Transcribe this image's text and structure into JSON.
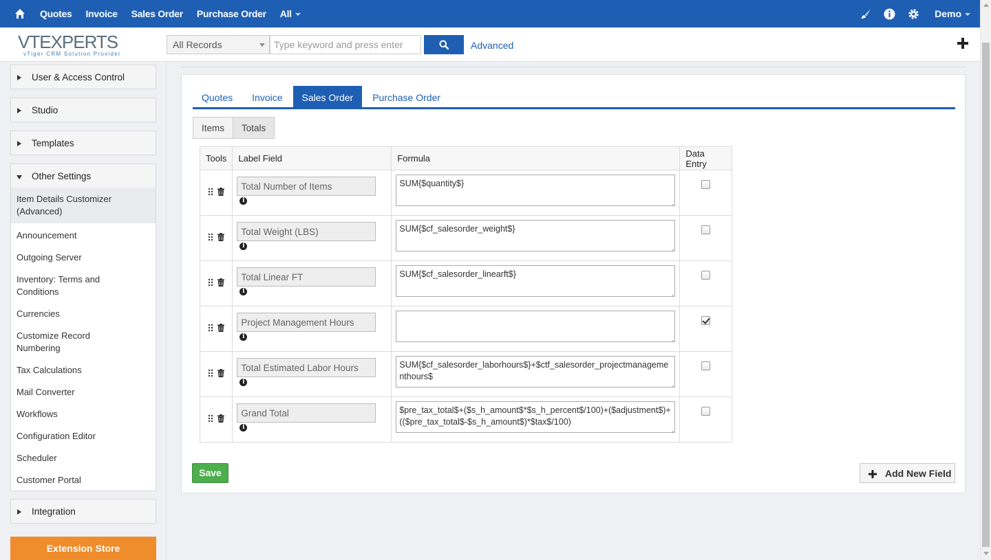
{
  "topnav": {
    "items": [
      "Quotes",
      "Invoice",
      "Sales Order",
      "Purchase Order",
      "All"
    ],
    "user": "Demo",
    "icons": [
      "home-icon",
      "brush-icon",
      "info-icon",
      "gear-icon"
    ]
  },
  "header": {
    "logo_main": "VTEXPERTS",
    "logo_sub": "vTiger CRM Solution Provider",
    "record_select": "All Records",
    "search_placeholder": "Type keyword and press enter",
    "advanced": "Advanced"
  },
  "sidebar": {
    "sections": [
      "User & Access Control",
      "Studio",
      "Templates",
      "Other Settings",
      "Integration"
    ],
    "items": [
      "Item Details Customizer (Advanced)",
      "Announcement",
      "Outgoing Server",
      "Inventory: Terms and Conditions",
      "Currencies",
      "Customize Record Numbering",
      "Tax Calculations",
      "Mail Converter",
      "Workflows",
      "Configuration Editor",
      "Scheduler",
      "Customer Portal"
    ],
    "extension_store": "Extension Store"
  },
  "main": {
    "tabs": [
      "Quotes",
      "Invoice",
      "Sales Order",
      "Purchase Order"
    ],
    "active_tab": "Sales Order",
    "subtabs": [
      "Items",
      "Totals"
    ],
    "columns": [
      "Tools",
      "Label Field",
      "Formula",
      "Data Entry"
    ],
    "rows": [
      {
        "label": "Total Number of Items",
        "formula": "SUM{$quantity$}",
        "data_entry": false
      },
      {
        "label": "Total Weight (LBS)",
        "formula": "SUM{$cf_salesorder_weight$}",
        "data_entry": false
      },
      {
        "label": "Total Linear FT",
        "formula": "SUM{$cf_salesorder_linearft$}",
        "data_entry": false
      },
      {
        "label": "Project Management Hours",
        "formula": "",
        "data_entry": true
      },
      {
        "label": "Total Estimated Labor Hours",
        "formula": "SUM{$cf_salesorder_laborhours$}+$ctf_salesorder_projectmanagementhours$",
        "data_entry": false
      },
      {
        "label": "Grand Total",
        "formula": "$pre_tax_total$+($s_h_amount$*$s_h_percent$/100)+($adjustment$)+(($pre_tax_total$-$s_h_amount$)*$tax$/100)",
        "data_entry": false
      }
    ],
    "save": "Save",
    "add_new_field": "Add New Field"
  }
}
